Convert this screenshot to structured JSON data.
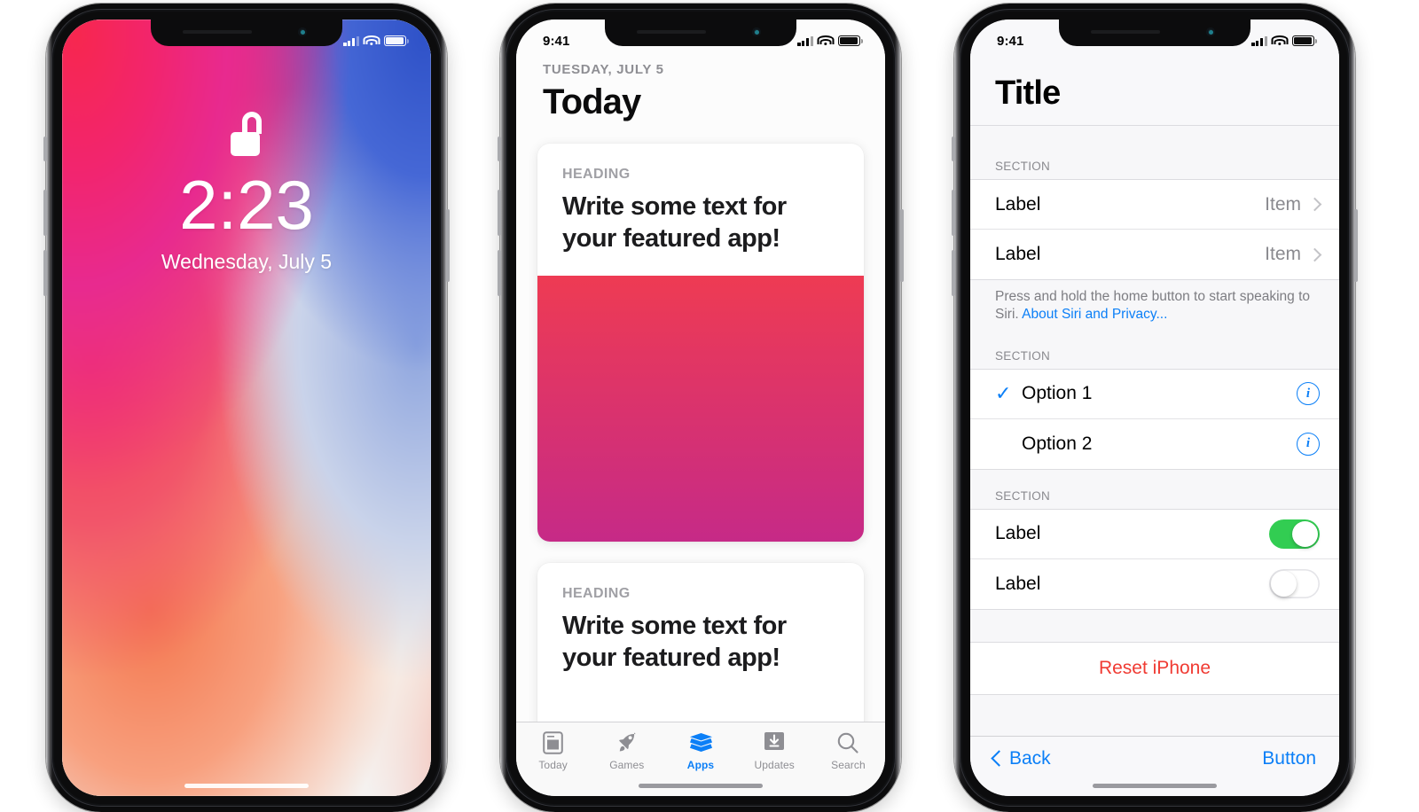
{
  "phone1": {
    "name": "iPhone X Lock Screen",
    "status": {
      "time": "",
      "signal_icon": "cellular-bars-icon",
      "wifi_icon": "wifi-icon",
      "battery_icon": "battery-icon"
    },
    "lock": {
      "lock_icon": "unlocked-padlock-icon",
      "time": "2:23",
      "date": "Wednesday, July 5"
    }
  },
  "phone2": {
    "name": "App Store Today",
    "status": {
      "time": "9:41",
      "signal_icon": "cellular-bars-icon",
      "wifi_icon": "wifi-icon",
      "battery_icon": "battery-icon"
    },
    "header": {
      "date": "TUESDAY, JULY 5",
      "title": "Today"
    },
    "cards": [
      {
        "heading": "HEADING",
        "title": "Write some text for your featured app!",
        "has_art": true,
        "art_gradient_from": "#EE3B53",
        "art_gradient_to": "#C62A87"
      },
      {
        "heading": "HEADING",
        "title": "Write some text for your featured app!",
        "has_art": false
      }
    ],
    "tabs": [
      {
        "label": "Today",
        "icon": "today-card-icon",
        "active": false
      },
      {
        "label": "Games",
        "icon": "rocket-icon",
        "active": false
      },
      {
        "label": "Apps",
        "icon": "stacked-layers-icon",
        "active": true
      },
      {
        "label": "Updates",
        "icon": "download-arrow-icon",
        "active": false
      },
      {
        "label": "Search",
        "icon": "search-icon",
        "active": false
      }
    ],
    "accent": "#0B7FF7"
  },
  "phone3": {
    "name": "Settings Detail",
    "status": {
      "time": "9:41",
      "signal_icon": "cellular-bars-icon",
      "wifi_icon": "wifi-icon",
      "battery_icon": "battery-icon"
    },
    "nav_title": "Title",
    "section1": {
      "label": "SECTION",
      "rows": [
        {
          "label": "Label",
          "value": "Item",
          "accessory": "chevron-right-icon"
        },
        {
          "label": "Label",
          "value": "Item",
          "accessory": "chevron-right-icon"
        }
      ],
      "footnote_text": "Press and hold the home button to start speaking to Siri. ",
      "footnote_link": "About Siri and Privacy..."
    },
    "section2": {
      "label": "SECTION",
      "rows": [
        {
          "label": "Option 1",
          "checked": true,
          "accessory": "info-circle-icon"
        },
        {
          "label": "Option 2",
          "checked": false,
          "accessory": "info-circle-icon"
        }
      ]
    },
    "section3": {
      "label": "SECTION",
      "rows": [
        {
          "label": "Label",
          "on": true
        },
        {
          "label": "Label",
          "on": false
        }
      ]
    },
    "destructive_label": "Reset iPhone",
    "toolbar": {
      "back_label": "Back",
      "button_label": "Button"
    },
    "colors": {
      "accent": "#0B7FF7",
      "destructive": "#F03B33",
      "switch_on": "#32CD52"
    }
  }
}
